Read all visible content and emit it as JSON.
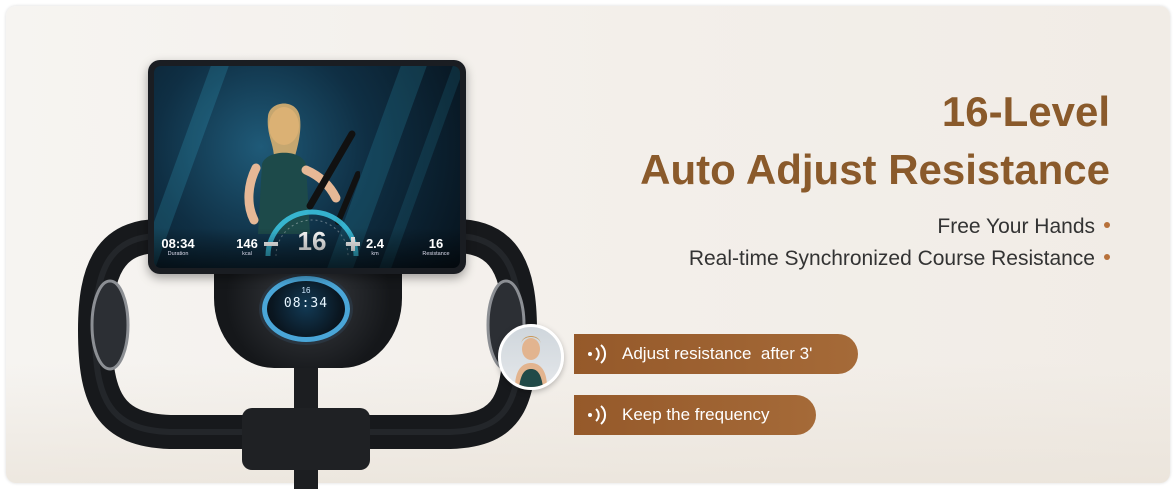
{
  "headline": {
    "line1": "16-Level",
    "line2": "Auto Adjust Resistance"
  },
  "features": [
    "Free Your Hands",
    "Real-time Synchronized Course Resistance"
  ],
  "coach_prompts": [
    {
      "text": "Adjust resistance  after 3'",
      "icon": "sound-wave-icon"
    },
    {
      "text": "Keep the frequency",
      "icon": "sound-wave-icon"
    }
  ],
  "tablet": {
    "stats": [
      {
        "value": "08:34",
        "label": "Duration"
      },
      {
        "value": "146",
        "label": "kcal"
      },
      {
        "value": "2.4",
        "label": "km"
      },
      {
        "value": "16",
        "label": "Resistance"
      }
    ],
    "dial_value": "16"
  },
  "console": {
    "level": "16",
    "time": "08:34"
  },
  "colors": {
    "accent": "#8a5a2b",
    "pill": "#9c6130",
    "bullet_dot": "#b8713a",
    "screen_glow": "#3cc8e6"
  }
}
